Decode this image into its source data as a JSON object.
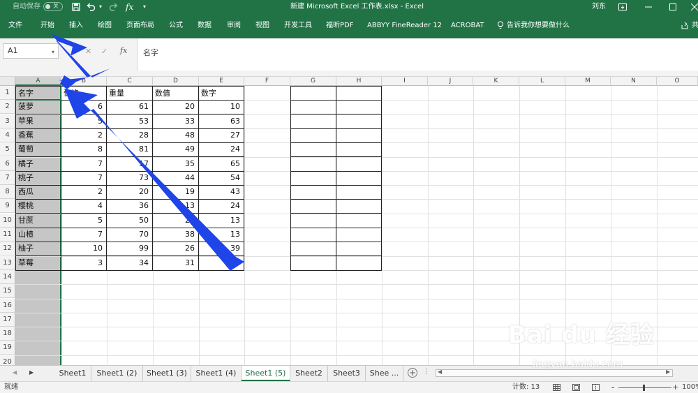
{
  "titlebar": {
    "autosave_label": "自动保存",
    "autosave_state": "关",
    "title": "新建 Microsoft Excel 工作表.xlsx  -  Excel",
    "user": "刘东",
    "fx_symbol": "fx",
    "qat_icons": [
      "save-icon",
      "undo-icon",
      "dropdown-icon",
      "fx-icon",
      "customize-icon"
    ],
    "window_icons": [
      "ribbon-display-icon",
      "minimize-icon",
      "maximize-icon",
      "close-icon"
    ]
  },
  "ribbon": {
    "tabs": [
      "文件",
      "开始",
      "插入",
      "绘图",
      "页面布局",
      "公式",
      "数据",
      "审阅",
      "视图",
      "开发工具",
      "福昕PDF",
      "ABBYY FineReader 12",
      "ACROBAT"
    ],
    "tell_me": "告诉我你想要做什么",
    "share": "共"
  },
  "formula_bar": {
    "name_box": "A1",
    "fx_label": "fx",
    "content": "名字"
  },
  "grid": {
    "columns": [
      "A",
      "B",
      "C",
      "D",
      "E",
      "F",
      "G",
      "H",
      "I",
      "J",
      "K",
      "L",
      "M",
      "N",
      "O"
    ],
    "rows": [
      "1",
      "2",
      "3",
      "4",
      "5",
      "6",
      "7",
      "8",
      "9",
      "10",
      "11",
      "12",
      "13",
      "14",
      "15",
      "16",
      "17",
      "18",
      "19",
      "20"
    ],
    "headers": [
      "名字",
      "价格",
      "重量",
      "数值",
      "数字"
    ],
    "data": [
      [
        "菠萝",
        "6",
        "61",
        "20",
        "10"
      ],
      [
        "苹果",
        "5",
        "53",
        "33",
        "63"
      ],
      [
        "香蕉",
        "2",
        "28",
        "48",
        "27"
      ],
      [
        "葡萄",
        "8",
        "81",
        "49",
        "24"
      ],
      [
        "橘子",
        "7",
        "17",
        "35",
        "65"
      ],
      [
        "桃子",
        "7",
        "73",
        "44",
        "54"
      ],
      [
        "西瓜",
        "2",
        "20",
        "19",
        "43"
      ],
      [
        "樱桃",
        "4",
        "36",
        "13",
        "24"
      ],
      [
        "甘蔗",
        "5",
        "50",
        "23",
        "13"
      ],
      [
        "山楂",
        "7",
        "70",
        "38",
        "13"
      ],
      [
        "柚子",
        "10",
        "99",
        "26",
        "39"
      ],
      [
        "草莓",
        "3",
        "34",
        "31",
        "16"
      ]
    ]
  },
  "sheets": {
    "tabs": [
      "Sheet1",
      "Sheet1 (2)",
      "Sheet1 (3)",
      "Sheet1 (4)",
      "Sheet1 (5)",
      "Sheet2",
      "Sheet3",
      "Shee ..."
    ],
    "active_index": 4,
    "add_icon": "add-sheet-icon"
  },
  "status": {
    "ready": "就绪",
    "count": "计数: 13",
    "zoom": "100%",
    "minus": "-",
    "plus": "+"
  },
  "watermark": {
    "brand": "Bai du 经验",
    "url": "jingyan.baidu.com"
  },
  "colors": {
    "excel_green": "#217346",
    "arrow_blue": "#1f44e8"
  }
}
